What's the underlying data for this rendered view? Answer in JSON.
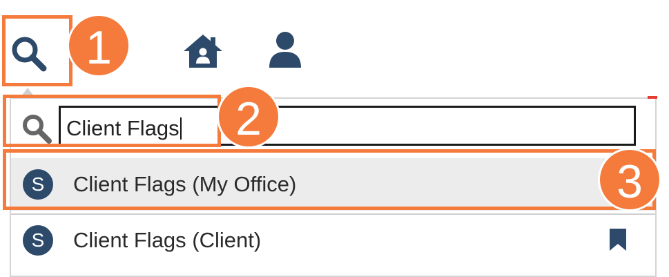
{
  "toolbar": {
    "search_icon": "search-icon",
    "home_icon": "home-icon",
    "user_icon": "user-icon"
  },
  "steps": [
    "1",
    "2",
    "3"
  ],
  "search": {
    "icon": "search-icon",
    "value": "Client Flags"
  },
  "results": [
    {
      "avatar": "S",
      "label": "Client Flags (My Office)",
      "highlighted": true
    },
    {
      "avatar": "S",
      "label": "Client Flags (Client)",
      "icon": "bookmark-icon"
    }
  ],
  "colors": {
    "accent": "#f47b3c",
    "icon": "#2d4a6b",
    "avatar": "#2d4a6b",
    "highlight_row": "#ececec",
    "flag_red": "#e43c2f"
  }
}
